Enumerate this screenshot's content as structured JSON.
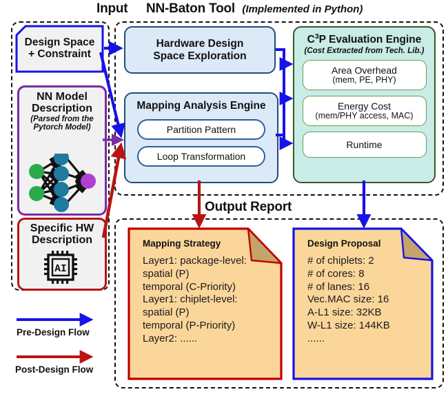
{
  "sections": {
    "input_title": "Input",
    "tool_title": "NN-Baton Tool",
    "tool_subtitle": "(Implemented in Python)",
    "output_title": "Output Report"
  },
  "input": {
    "design_space": {
      "line1": "Design Space",
      "line2": "+ Constraint"
    },
    "nn_model": {
      "line1": "NN Model",
      "line2": "Description",
      "sub1": "(Parsed from the",
      "sub2": "Pytorch Model)",
      "graphic": "neural-network-diagram",
      "node_colors": {
        "input": "#2aaa4b",
        "hidden": "#1e7a9e",
        "output": "#b13fd1"
      }
    },
    "specific_hw": {
      "line1": "Specific HW",
      "line2": "Description",
      "icon_label": "AI",
      "graphic": "ai-chip-icon"
    }
  },
  "tool": {
    "hardware_dse": {
      "line1": "Hardware Design",
      "line2": "Space Exploration"
    },
    "mapping_engine": {
      "header": "Mapping Analysis Engine",
      "items": [
        {
          "label": "Partition Pattern"
        },
        {
          "label": "Loop Transformation"
        }
      ]
    },
    "c3p": {
      "header_pre": "C",
      "header_sup": "3",
      "header_post": "P Evaluation Engine",
      "subtitle": "(Cost Extracted from Tech. Lib.)",
      "items": [
        {
          "line1": "Area Overhead",
          "line2": "(mem, PE, PHY)"
        },
        {
          "line1": "Energy Cost",
          "line2": "(mem/PHY access, MAC)"
        },
        {
          "line1": "Runtime",
          "line2": ""
        }
      ]
    }
  },
  "output": {
    "mapping_strategy": {
      "title": "Mapping Strategy",
      "lines": [
        "Layer1: package-level:",
        "spatial (P)",
        "temporal (C-Priority)",
        "Layer1: chiplet-level:",
        "spatial (P)",
        "temporal (P-Priority)",
        "Layer2: ......"
      ]
    },
    "design_proposal": {
      "title": "Design Proposal",
      "lines": [
        "# of chiplets: 2",
        "# of cores: 8",
        "# of lanes: 16",
        "Vec.MAC size: 16",
        "A-L1 size: 32KB",
        "W-L1 size: 144KB",
        "......"
      ]
    }
  },
  "legend": {
    "pre_design": "Pre-Design Flow",
    "post_design": "Post-Design Flow"
  },
  "colors": {
    "pre_flow": "#1712e8",
    "post_flow": "#b81414",
    "blue_box_border": "#1f4e79",
    "blue_box_fill": "#dce9f7",
    "green_box_border": "#375623",
    "green_box_fill": "#c9ece6",
    "note_fill": "#fbd69a",
    "note_fold": "#c3a46a",
    "dashed_border": "#111111"
  }
}
